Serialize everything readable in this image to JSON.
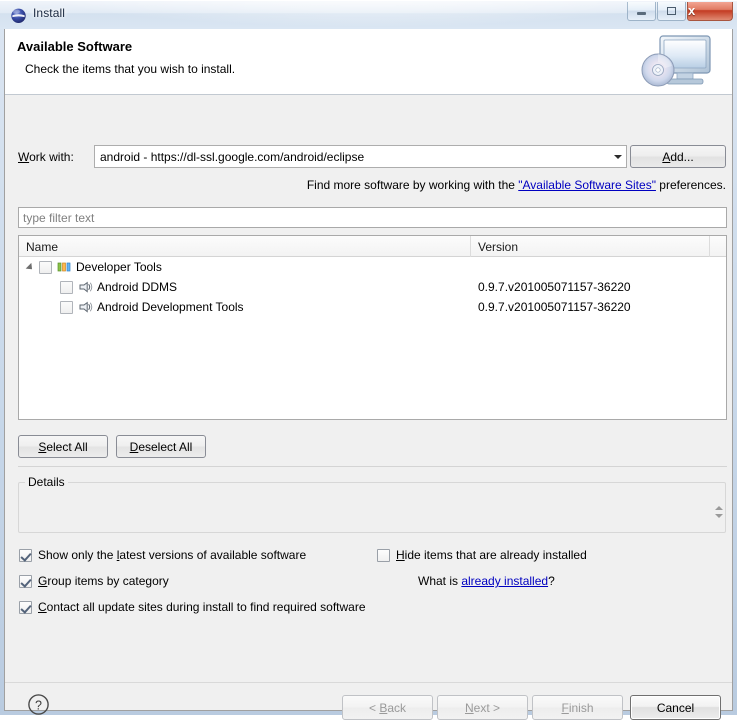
{
  "window": {
    "title": "Install",
    "icon": "eclipse-sphere-icon",
    "caption_buttons": [
      {
        "name": "minimize",
        "glyph": "minimize-icon"
      },
      {
        "name": "restore",
        "glyph": "restore-icon"
      },
      {
        "name": "close",
        "glyph": "close-icon",
        "label": "x"
      }
    ]
  },
  "banner": {
    "title": "Available Software",
    "subtitle": "Check the items that you wish to install.",
    "icon": "monitor-disc-icon"
  },
  "workwith": {
    "label_prefix": "W",
    "label_rest": "ork with:",
    "value": "android - https://dl-ssl.google.com/android/eclipse",
    "add_button_mnemonic": "A",
    "add_button_rest": "dd..."
  },
  "find_more": {
    "before": "Find more software by working with the ",
    "link": "\"Available Software Sites\"",
    "after": " preferences."
  },
  "filter": {
    "placeholder": "type filter text",
    "value": ""
  },
  "table": {
    "columns": [
      {
        "key": "name",
        "label": "Name"
      },
      {
        "key": "version",
        "label": "Version"
      },
      {
        "key": "extra",
        "label": ""
      }
    ],
    "rows": [
      {
        "level": 0,
        "expander": true,
        "checked": false,
        "icon": "category-bars-icon",
        "name": "Developer Tools",
        "version": ""
      },
      {
        "level": 1,
        "expander": false,
        "checked": false,
        "icon": "feature-plug-icon",
        "name": "Android DDMS",
        "version": "0.9.7.v201005071157-36220"
      },
      {
        "level": 1,
        "expander": false,
        "checked": false,
        "icon": "feature-plug-icon",
        "name": "Android Development Tools",
        "version": "0.9.7.v201005071157-36220"
      }
    ]
  },
  "selection_buttons": {
    "select_all_mnemonic": "S",
    "select_all_rest": "elect All",
    "deselect_all_mnemonic": "D",
    "deselect_all_rest": "eselect All"
  },
  "details": {
    "legend": "Details",
    "content": ""
  },
  "options": [
    {
      "name": "show-latest-versions",
      "checked": true,
      "pre": "Show only the ",
      "mnemonic": "l",
      "post": "atest versions of available software"
    },
    {
      "name": "group-by-category",
      "checked": true,
      "pre": "",
      "mnemonic": "G",
      "post": "roup items by category"
    },
    {
      "name": "contact-update-sites",
      "checked": true,
      "pre": "",
      "mnemonic": "C",
      "post": "ontact all update sites during install to find required software"
    },
    {
      "name": "hide-installed-items",
      "checked": false,
      "pre": "",
      "mnemonic": "H",
      "post": "ide items that are already installed"
    }
  ],
  "whatis": {
    "before": "What is ",
    "link": "already installed",
    "after": "?"
  },
  "footer": {
    "help_icon": "help-question-icon",
    "buttons": [
      {
        "name": "back",
        "pre": "< ",
        "mnemonic": "B",
        "post": "ack",
        "enabled": false
      },
      {
        "name": "next",
        "pre": "",
        "mnemonic": "N",
        "post": "ext >",
        "enabled": false
      },
      {
        "name": "finish",
        "pre": "",
        "mnemonic": "F",
        "post": "inish",
        "enabled": false
      },
      {
        "name": "cancel",
        "pre": "",
        "mnemonic": "",
        "post": "Cancel",
        "enabled": true
      }
    ]
  },
  "colors": {
    "link": "#0000c0",
    "dialog_bg": "#f0f0f0",
    "banner_bg": "#ffffff",
    "close_button": "#c33b22"
  }
}
